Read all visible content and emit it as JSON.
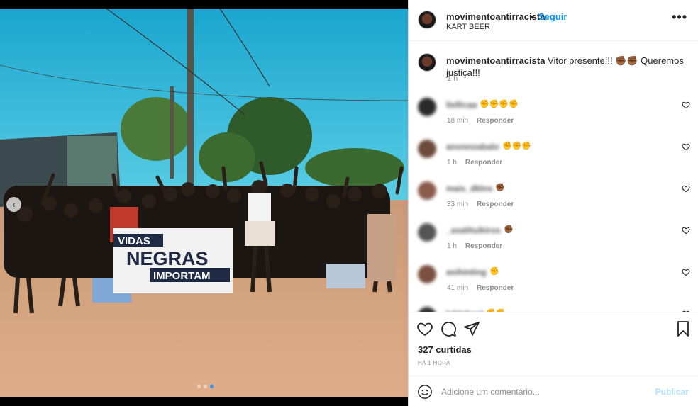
{
  "post": {
    "username": "movimentoantirracista",
    "separator": "•",
    "follow_label": "Seguir",
    "location": "KART BEER",
    "more_label": "•••"
  },
  "caption": {
    "username": "movimentoantirracista",
    "text": " Vitor presente!!! ✊🏾✊🏾 Queremos justiça!!!",
    "time": "1 h"
  },
  "banner": {
    "line1": "VIDAS",
    "line2": "NEGRAS",
    "line3": "IMPORTAM"
  },
  "comments": [
    {
      "username": "liellicaa",
      "emoji": "✊✊✊✊",
      "time": "18 min",
      "reply_label": "Responder",
      "avatar_color": "#2a2a2a"
    },
    {
      "username": "anonnoabalo",
      "emoji": "✊✊✊",
      "time": "1 h",
      "reply_label": "Responder",
      "avatar_color": "#6d4a3a"
    },
    {
      "username": "mais_dklns",
      "emoji": "✊🏾",
      "time": "33 min",
      "reply_label": "Responder",
      "avatar_color": "#8a5a4a"
    },
    {
      "username": "_asalituikiros",
      "emoji": "✊🏾",
      "time": "1 h",
      "reply_label": "Responder",
      "avatar_color": "#555"
    },
    {
      "username": "asihinting",
      "emoji": "✊",
      "time": "41 min",
      "reply_label": "Responder",
      "avatar_color": "#7a5040"
    },
    {
      "username": "lahlahaol",
      "emoji": "✊✊",
      "time": "",
      "reply_label": "",
      "avatar_color": "#333"
    }
  ],
  "likes": "327 curtidas",
  "time_ago": "HÁ 1 HORA",
  "add_comment": {
    "placeholder": "Adicione um comentário...",
    "publish_label": "Publicar"
  },
  "carousel": {
    "prev_label": "‹",
    "count": 3,
    "active": 3
  },
  "colors": {
    "accent": "#0095f6",
    "publish_disabled": "#b2dffc",
    "sky": "#36b6d6",
    "ground": "#d7a079"
  }
}
